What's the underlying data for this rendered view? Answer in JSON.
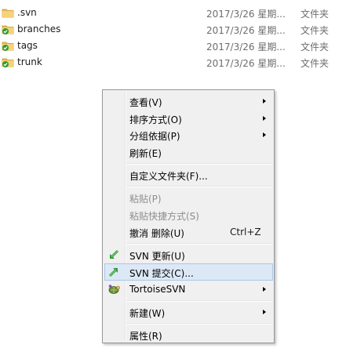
{
  "files": [
    {
      "name": ".svn",
      "date": "2017/3/26 星期...",
      "type": "文件夹",
      "icon": "folder-icon"
    },
    {
      "name": "branches",
      "date": "2017/3/26 星期...",
      "type": "文件夹",
      "icon": "svn-folder-ok-icon"
    },
    {
      "name": "tags",
      "date": "2017/3/26 星期...",
      "type": "文件夹",
      "icon": "svn-folder-ok-icon"
    },
    {
      "name": "trunk",
      "date": "2017/3/26 星期...",
      "type": "文件夹",
      "icon": "svn-folder-ok-icon"
    }
  ],
  "menu": {
    "view": "查看(V)",
    "sort": "排序方式(O)",
    "group": "分组依据(P)",
    "refresh": "刷新(E)",
    "customize": "自定义文件夹(F)...",
    "paste": "粘贴(P)",
    "paste_shortcut": "粘贴快捷方式(S)",
    "undo_delete": "撤消 删除(U)",
    "undo_shortcut": "Ctrl+Z",
    "svn_update": "SVN 更新(U)",
    "svn_commit": "SVN 提交(C)...",
    "tortoisesvn": "TortoiseSVN",
    "new": "新建(W)",
    "properties": "属性(R)"
  },
  "colors": {
    "menu_bg": "#f0f0f0",
    "hover_bg": "#dce8f5",
    "hover_border": "#a8c8ea",
    "folder_yellow": "#e8b84a",
    "svn_green": "#2e9b2e"
  }
}
